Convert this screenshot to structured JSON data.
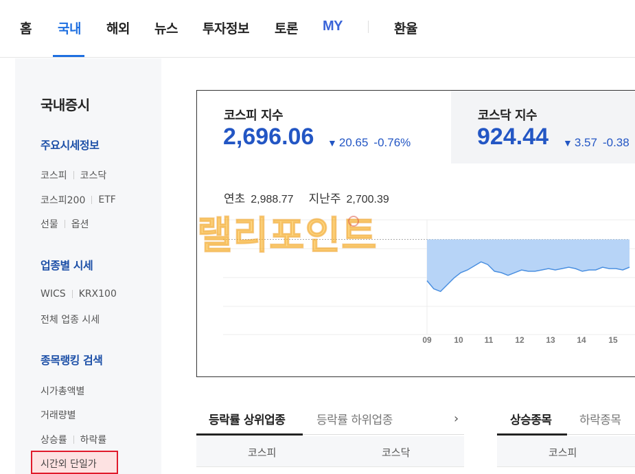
{
  "nav": {
    "items": [
      "홈",
      "국내",
      "해외",
      "뉴스",
      "투자정보",
      "토론",
      "MY",
      "환율"
    ],
    "active": "국내"
  },
  "sidebar": {
    "title": "국내증시",
    "sections": [
      {
        "title": "주요시세정보",
        "rows": [
          [
            "코스피",
            "코스닥"
          ],
          [
            "코스피200",
            "ETF"
          ],
          [
            "선물",
            "옵션"
          ]
        ]
      },
      {
        "title": "업종별 시세",
        "rows": [
          [
            "WICS",
            "KRX100"
          ],
          [
            "전체 업종 시세"
          ]
        ]
      },
      {
        "title": "종목랭킹 검색",
        "rows": [
          [
            "시가총액별"
          ],
          [
            "거래량별"
          ],
          [
            "상승률",
            "하락률"
          ]
        ]
      }
    ],
    "highlighted_item": "시간외 단일가"
  },
  "indices": {
    "kospi": {
      "name": "코스피 지수",
      "value": "2,696.06",
      "change": "20.65",
      "pct": "-0.76%"
    },
    "kosdaq": {
      "name": "코스닥 지수",
      "value": "924.44",
      "change": "3.57",
      "pct": "-0.38"
    },
    "stats": {
      "ytd_label": "연초",
      "ytd_value": "2,988.77",
      "lastweek_label": "지난주",
      "lastweek_value": "2,700.39"
    }
  },
  "watermark": "랠리포인트",
  "chart_data": {
    "type": "area",
    "x_ticks": [
      "09",
      "10",
      "11",
      "12",
      "13",
      "14",
      "15"
    ],
    "series": [
      {
        "values": [
          2686,
          2680,
          2678,
          2683,
          2688,
          2692,
          2694,
          2697,
          2700,
          2698,
          2693,
          2692,
          2690,
          2692,
          2694,
          2693,
          2693,
          2694,
          2695,
          2694,
          2695,
          2696,
          2695,
          2693,
          2694,
          2694,
          2696,
          2695,
          2695,
          2694,
          2696
        ]
      }
    ],
    "previous_close": 2716.71,
    "colors": {
      "area": "#b7d4f7",
      "line": "#4a8fe0",
      "ref": "#aaaaaa"
    }
  },
  "bottom_left_tabs": {
    "tabs": [
      "등락률 상위업종",
      "등락률 하위업종"
    ],
    "columns": [
      "코스피",
      "코스닥"
    ],
    "next_icon": "chevron-right-icon"
  },
  "bottom_right_tabs": {
    "tabs": [
      "상승종목",
      "하락종목"
    ],
    "columns": [
      "코스피"
    ]
  }
}
